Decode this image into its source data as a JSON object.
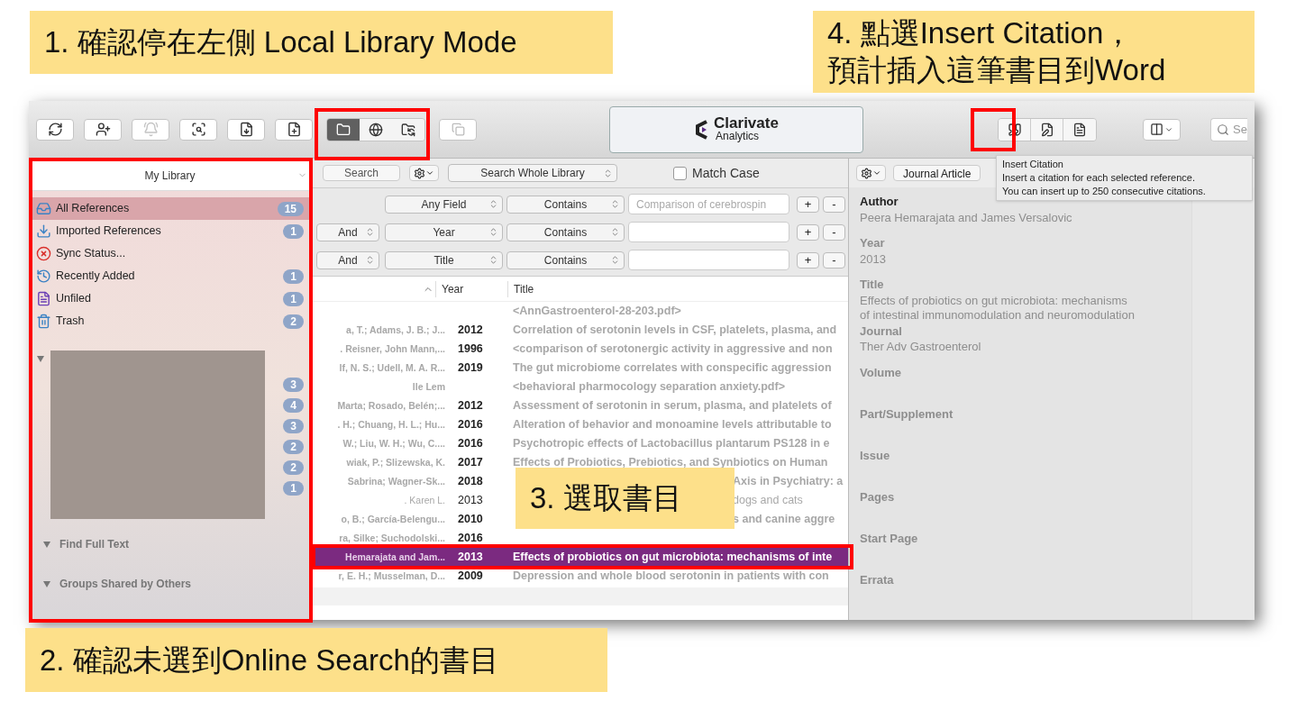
{
  "callouts": {
    "step1": "1. 確認停在左側 Local Library Mode",
    "step2": "2. 確認未選到Online Search的書目",
    "step3": "3. 選取書目",
    "step4": [
      "4. 點選Insert Citation，",
      "預計插入這筆書目到Word"
    ]
  },
  "toolbar": {
    "left_buttons": [
      {
        "kind": "sync",
        "disabled": false
      },
      {
        "kind": "share",
        "disabled": false
      },
      {
        "kind": "activity",
        "disabled": true
      },
      {
        "kind": "find-pdf",
        "disabled": false
      },
      {
        "kind": "import",
        "disabled": false
      },
      {
        "kind": "new-ref",
        "disabled": false
      }
    ],
    "mode_tabs": [
      {
        "kind": "local",
        "selected": true
      },
      {
        "kind": "online",
        "selected": false
      },
      {
        "kind": "integrated",
        "selected": false
      }
    ],
    "logo": {
      "line1": "Clarivate",
      "line2": "Analytics"
    },
    "word_buttons": [
      {
        "kind": "insert-citation"
      },
      {
        "kind": "edit"
      },
      {
        "kind": "word"
      }
    ],
    "search_placeholder": "Se"
  },
  "tooltip": {
    "title": "Insert Citation",
    "lines": [
      "Insert a citation for each selected reference.",
      "You can insert up to 250 consecutive citations."
    ]
  },
  "sidebar": {
    "title": "My Library",
    "items": [
      {
        "kind": "all",
        "label": "All References",
        "count": "15",
        "selected": true
      },
      {
        "kind": "imported",
        "label": "Imported References",
        "count": "1",
        "selected": false
      },
      {
        "kind": "sync",
        "label": "Sync Status...",
        "selected": false
      },
      {
        "kind": "recent",
        "label": "Recently Added",
        "count": "1",
        "selected": false
      },
      {
        "kind": "unfiled",
        "label": "Unfiled",
        "count": "1",
        "selected": false
      },
      {
        "kind": "trash",
        "label": "Trash",
        "count": "2",
        "selected": false
      }
    ],
    "group_counts": [
      "3",
      "4",
      "3",
      "2",
      "2",
      "1"
    ],
    "sections": [
      {
        "label": "Find Full Text",
        "expanded": true
      },
      {
        "label": "Groups Shared by Others",
        "expanded": true
      }
    ]
  },
  "search": {
    "button": "Search",
    "scope": "Search Whole Library",
    "match_case": {
      "label": "Match Case",
      "checked": false
    },
    "rows": [
      {
        "field": "Any Field",
        "operator": "Contains",
        "value": "Comparison of cerebrospin",
        "add": "+",
        "remove": "-"
      },
      {
        "connector": "And",
        "field": "Year",
        "operator": "Contains",
        "add": "+",
        "remove": "-"
      },
      {
        "connector": "And",
        "field": "Title",
        "operator": "Contains",
        "add": "+",
        "remove": "-"
      }
    ]
  },
  "table": {
    "columns": [
      "Year",
      "Title"
    ],
    "rows": [
      {
        "kind": "normal",
        "author": "",
        "year": "",
        "title": "<AnnGastroenterol-28-203.pdf>",
        "unread": true,
        "selected": false
      },
      {
        "kind": "normal",
        "author": "a, T.; Adams, J. B.; J...",
        "year": "2012",
        "title": "Correlation of serotonin levels in CSF, platelets, plasma, and",
        "unread": true,
        "selected": false
      },
      {
        "kind": "normal",
        "author": ". Reisner, John Mann,...",
        "year": "1996",
        "title": "<comparison of serotonergic activity in aggressive and non",
        "unread": true,
        "selected": false
      },
      {
        "kind": "normal",
        "author": "lf, N. S.; Udell, M. A. R...",
        "year": "2019",
        "title": "The gut microbiome correlates with conspecific aggression",
        "unread": true,
        "selected": false
      },
      {
        "kind": "normal",
        "author": "lle Lem",
        "year": "",
        "title": "<behavioral pharmocology separation anxiety.pdf>",
        "unread": true,
        "selected": false
      },
      {
        "kind": "normal",
        "author": "Marta; Rosado, Belén;...",
        "year": "2012",
        "title": "Assessment of serotonin in serum, plasma, and platelets of",
        "unread": true,
        "selected": false
      },
      {
        "kind": "normal",
        "author": ". H.; Chuang, H. L.; Hu...",
        "year": "2016",
        "title": "Alteration of behavior and monoamine levels attributable to",
        "unread": true,
        "selected": false
      },
      {
        "kind": "normal",
        "author": "W.; Liu, W. H.; Wu, C....",
        "year": "2016",
        "title": "Psychotropic effects of Lactobacillus plantarum PS128 in e",
        "unread": true,
        "selected": false
      },
      {
        "kind": "normal",
        "author": "wiak, P.; Slizewska, K.",
        "year": "2017",
        "title": "Effects of Probiotics, Prebiotics, and Synbiotics on Human",
        "unread": true,
        "selected": false
      },
      {
        "kind": "covered",
        "author": "Sabrina; Wagner-Sk...",
        "year": "2018",
        "title": "Axis in Psychiatry: a",
        "unread": true,
        "selected": false
      },
      {
        "kind": "covered",
        "author": ". Karen L.",
        "year": "2013",
        "title": "dogs and cats",
        "unread": false,
        "selected": false
      },
      {
        "kind": "covered",
        "author": "o, B.; García-Belengu...",
        "year": "2010",
        "title": "s and canine aggre",
        "unread": true,
        "selected": false
      },
      {
        "kind": "normal",
        "author": "ra, Silke; Suchodolski...",
        "year": "2016",
        "unread": true,
        "selected": false
      },
      {
        "kind": "normal",
        "author": "Hemarajata and Jam...",
        "year": "2013",
        "title": "Effects of probiotics on gut microbiota: mechanisms of inte",
        "unread": true,
        "selected": true
      },
      {
        "kind": "normal",
        "author": "r, E. H.; Musselman, D...",
        "year": "2009",
        "title": "Depression and whole blood serotonin in patients with con",
        "unread": true,
        "selected": false
      }
    ]
  },
  "detail": {
    "reference_type": "Journal Article",
    "fields": [
      {
        "label": "Author",
        "value": "Peera Hemarajata and James Versalovic",
        "emphasized": true
      },
      {
        "label": "Year",
        "value": "2013",
        "emphasized": false
      },
      {
        "label": "Title",
        "value": "Effects of probiotics on gut microbiota: mechanisms of intestinal immunomodulation and neuromodulation",
        "emphasized": false
      },
      {
        "label": "Journal",
        "value": "Ther Adv Gastroenterol",
        "emphasized": false
      },
      {
        "label": "Volume",
        "emphasized": false
      },
      {
        "label": "Part/Supplement",
        "emphasized": false
      },
      {
        "label": "Issue",
        "emphasized": false
      },
      {
        "label": "Pages",
        "emphasized": false
      },
      {
        "label": "Start Page",
        "emphasized": false
      },
      {
        "label": "Errata",
        "emphasized": false
      }
    ]
  }
}
